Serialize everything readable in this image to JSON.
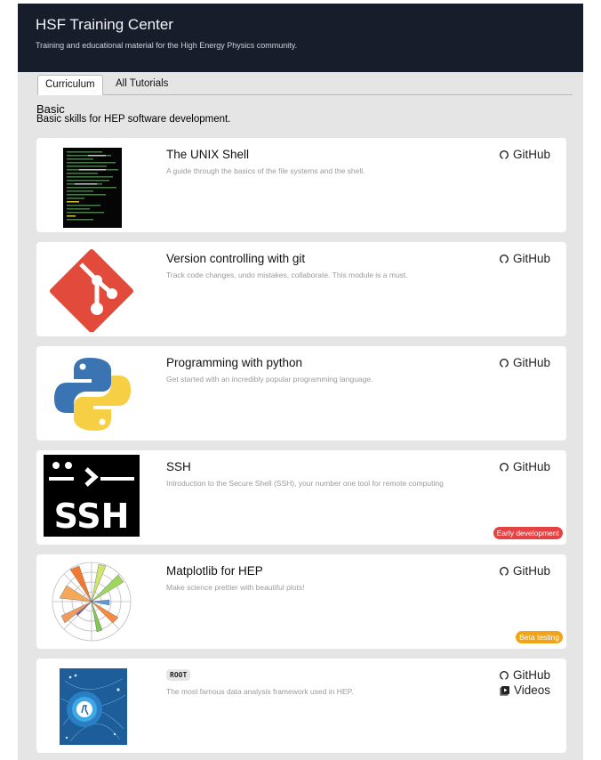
{
  "header": {
    "title": "HSF Training Center",
    "subtitle": "Training and educational material for the High Energy Physics community."
  },
  "tabs": [
    {
      "label": "Curriculum",
      "active": true
    },
    {
      "label": "All Tutorials",
      "active": false
    }
  ],
  "section": {
    "title": "Basic",
    "description": "Basic skills for HEP software development."
  },
  "modules": [
    {
      "title": "The UNIX Shell",
      "description": "A guide through the basics of the file systems and the shell.",
      "github_label": "GitHub",
      "icon": "terminal-screenshot-icon"
    },
    {
      "title": "Version controlling with git",
      "description": "Track code changes, undo mistakes, collaborate. This module is a must.",
      "github_label": "GitHub",
      "icon": "git-logo-icon"
    },
    {
      "title": "Programming with python",
      "description": "Get started with an incredibly popular programming language.",
      "github_label": "GitHub",
      "icon": "python-logo-icon"
    },
    {
      "title": "SSH",
      "description": "Introduction to the Secure Shell (SSH), your number one tool for remote computing",
      "github_label": "GitHub",
      "badge": "Early development",
      "badge_color": "#e34343",
      "icon": "ssh-logo-icon"
    },
    {
      "title": "Matplotlib for HEP",
      "description": "Make science prettier with beautiful plots!",
      "github_label": "GitHub",
      "badge": "Beta testing",
      "badge_color": "#f0a418",
      "icon": "matplotlib-logo-icon"
    },
    {
      "title": "ROOT",
      "description": "The most famous data analysis framework used in HEP.",
      "github_label": "GitHub",
      "videos_label": "Videos",
      "icon": "root-logo-icon"
    }
  ],
  "colors": {
    "header_bg": "#171d2a",
    "page_bg": "#e5e5e5",
    "early_badge": "#e34343",
    "beta_badge": "#f0a418"
  }
}
